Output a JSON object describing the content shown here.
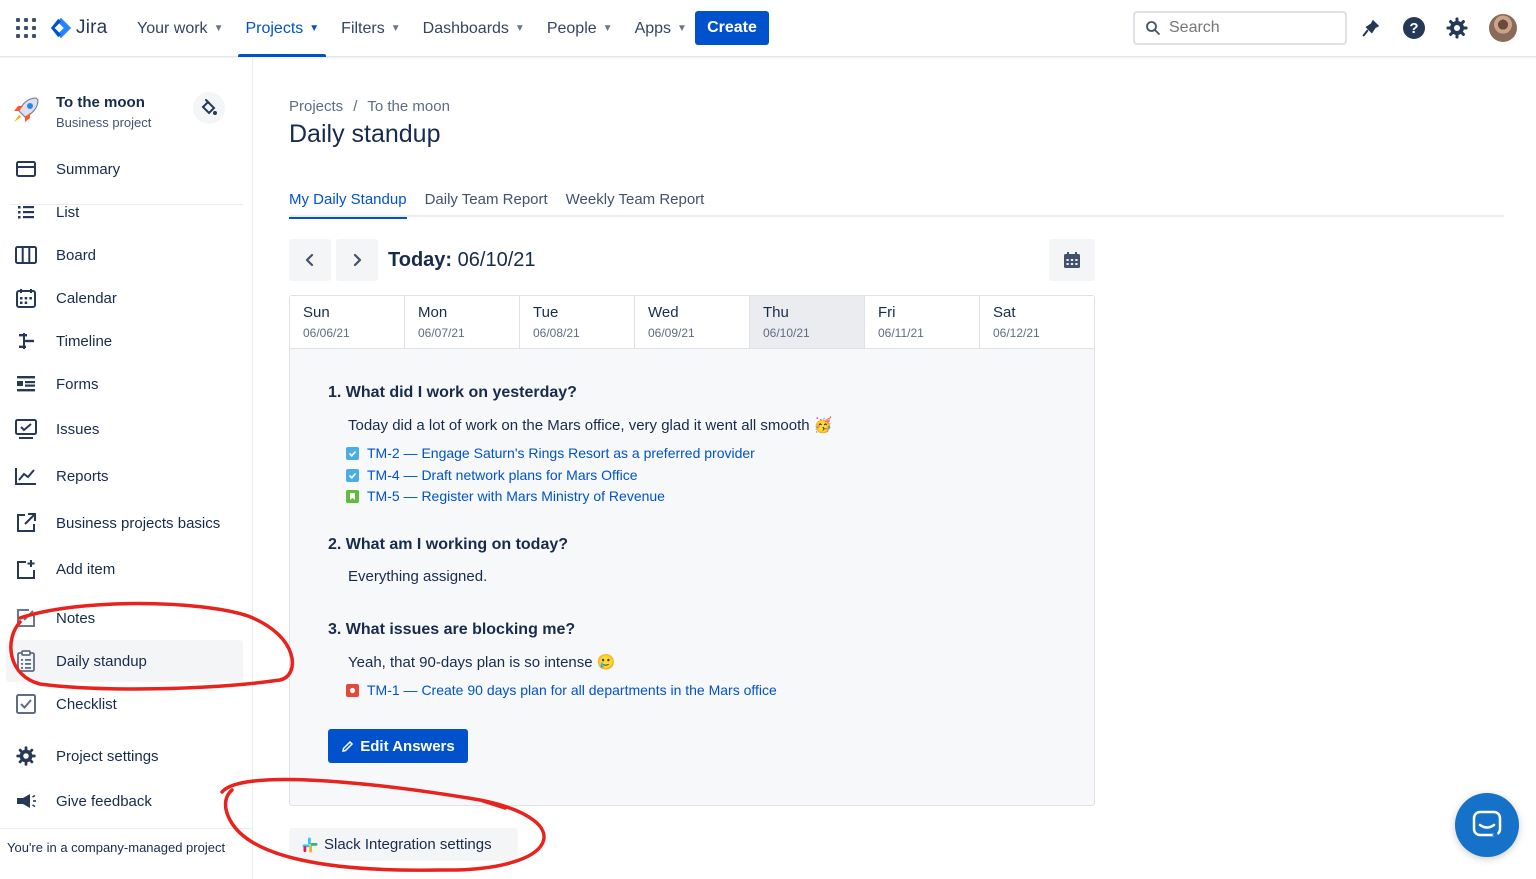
{
  "app": {
    "logo_text": "Jira"
  },
  "topnav": {
    "items": [
      {
        "label": "Your work"
      },
      {
        "label": "Projects"
      },
      {
        "label": "Filters"
      },
      {
        "label": "Dashboards"
      },
      {
        "label": "People"
      },
      {
        "label": "Apps"
      }
    ],
    "active": "Projects",
    "create_label": "Create",
    "search_placeholder": "Search",
    "icons": [
      "app-switcher-icon",
      "notifications-icon",
      "help-icon",
      "settings-icon",
      "avatar"
    ]
  },
  "project": {
    "name": "To the moon",
    "type": "Business project"
  },
  "sidebar": {
    "items": [
      {
        "label": "Summary",
        "icon": "summary-icon"
      },
      {
        "label": "List",
        "icon": "list-icon"
      },
      {
        "label": "Board",
        "icon": "board-icon"
      },
      {
        "label": "Calendar",
        "icon": "calendar-icon"
      },
      {
        "label": "Timeline",
        "icon": "timeline-icon"
      },
      {
        "label": "Forms",
        "icon": "forms-icon"
      },
      {
        "label": "Issues",
        "icon": "issues-icon"
      },
      {
        "label": "Reports",
        "icon": "reports-icon"
      },
      {
        "label": "Business projects basics",
        "icon": "external-link-icon"
      },
      {
        "label": "Add item",
        "icon": "add-item-icon"
      },
      {
        "label": "Notes",
        "icon": "notes-icon"
      },
      {
        "label": "Daily standup",
        "icon": "clipboard-icon"
      },
      {
        "label": "Checklist",
        "icon": "checklist-icon"
      },
      {
        "label": "Project settings",
        "icon": "gear-icon"
      },
      {
        "label": "Give feedback",
        "icon": "megaphone-icon"
      }
    ],
    "selected": "Daily standup",
    "footer": "You're in a company-managed project"
  },
  "breadcrumb": {
    "root": "Projects",
    "separator": "/",
    "project": "To the moon"
  },
  "page_title": "Daily standup",
  "tabs": [
    {
      "label": "My Daily Standup"
    },
    {
      "label": "Daily Team Report"
    },
    {
      "label": "Weekly Team Report"
    }
  ],
  "active_tab": "My Daily Standup",
  "date_nav": {
    "today_label": "Today:",
    "today_date": "06/10/21"
  },
  "week": [
    {
      "name": "Sun",
      "date": "06/06/21"
    },
    {
      "name": "Mon",
      "date": "06/07/21"
    },
    {
      "name": "Tue",
      "date": "06/08/21"
    },
    {
      "name": "Wed",
      "date": "06/09/21"
    },
    {
      "name": "Thu",
      "date": "06/10/21"
    },
    {
      "name": "Fri",
      "date": "06/11/21"
    },
    {
      "name": "Sat",
      "date": "06/12/21"
    }
  ],
  "current_day": "Thu",
  "questions": [
    {
      "title": "1. What did I work on yesterday?",
      "answer": "Today did a lot of work on the Mars office, very glad it went all smooth 🥳",
      "issues": [
        {
          "text": "TM-2 — Engage Saturn's Rings Resort as a preferred provider",
          "type": "task",
          "color": "#4bade8"
        },
        {
          "text": "TM-4 — Draft network plans for Mars Office",
          "type": "task",
          "color": "#4bade8"
        },
        {
          "text": "TM-5 — Register with Mars Ministry of Revenue",
          "type": "story",
          "color": "#63ba3c"
        }
      ]
    },
    {
      "title": "2. What am I working on today?",
      "answer": "Everything assigned.",
      "issues": []
    },
    {
      "title": "3. What issues are blocking me?",
      "answer": "Yeah, that 90-days plan is so intense 🥲",
      "issues": [
        {
          "text": "TM-1 — Create 90 days plan for all departments in the Mars office",
          "type": "bug",
          "color": "#e5493a"
        }
      ]
    }
  ],
  "edit_button": "Edit Answers",
  "slack_button": "Slack Integration settings",
  "colors": {
    "primary": "#0052cc",
    "annotation": "#e8231d",
    "chat": "#1572c8"
  }
}
